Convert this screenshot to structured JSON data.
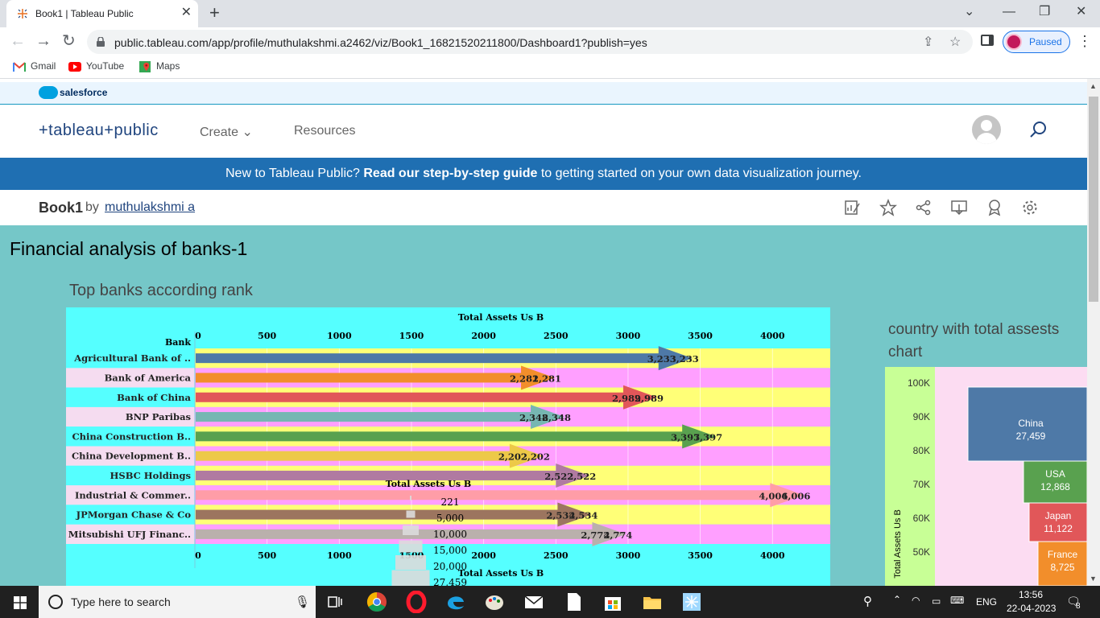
{
  "browser": {
    "tab_title": "Book1 | Tableau Public",
    "url": "public.tableau.com/app/profile/muthulakshmi.a2462/viz/Book1_16821520211800/Dashboard1?publish=yes",
    "profile_label": "Paused",
    "bookmarks": [
      "Gmail",
      "YouTube",
      "Maps"
    ]
  },
  "salesforce_label": "salesforce",
  "header": {
    "logo_text": "+tableau+public",
    "nav": [
      "Create",
      "Resources"
    ]
  },
  "promo": {
    "prefix": "New to Tableau Public? ",
    "bold": "Read our step-by-step guide",
    "suffix": " to getting started on your own data visualization journey."
  },
  "viz": {
    "title": "Book1",
    "by": "by",
    "author": "muthulakshmi a"
  },
  "dashboard": {
    "title": "Financial analysis of banks-1",
    "sheet1_title": "Top banks according rank",
    "sheet2_title": "country with total assests chart"
  },
  "chart_data": [
    {
      "type": "bar",
      "title": "Top banks according rank",
      "xlabel": "Total Assets Us B",
      "row_header": "Bank",
      "categories": [
        "Agricultural Bank of ..",
        "Bank of America",
        "Bank of China",
        "BNP Paribas",
        "China Construction B..",
        "China Development B..",
        "HSBC Holdings",
        "Industrial & Commer..",
        "JPMorgan Chase & Co",
        "Mitsubishi UFJ Financ.."
      ],
      "values": [
        3233,
        2281,
        2989,
        2348,
        3397,
        2202,
        2522,
        4006,
        2534,
        2774
      ],
      "value_labels": [
        "3,233",
        "2,281",
        "2,989",
        "2,348",
        "3,397",
        "2,202",
        "2,522",
        "4,006",
        "2,534",
        "2,774"
      ],
      "bar_colors": [
        "#4e79a7",
        "#f28e2b",
        "#e15759",
        "#76b7b2",
        "#59a14f",
        "#edc948",
        "#b07aa1",
        "#ff9da7",
        "#9c755f",
        "#bab0ac"
      ],
      "ticks": [
        "0",
        "500",
        "1000",
        "1500",
        "2000",
        "2500",
        "3000",
        "3500",
        "4000"
      ],
      "xlim": [
        0,
        4400
      ],
      "size_legend": {
        "title": "Total Assets Us B",
        "entries": [
          "221",
          "5,000",
          "10,000",
          "15,000",
          "20,000",
          "27,459"
        ]
      }
    },
    {
      "type": "treemap",
      "title": "country with total assests chart",
      "ylabel": "Total Assets Us B",
      "y_ticks": [
        "100K",
        "90K",
        "80K",
        "70K",
        "60K",
        "50K"
      ],
      "ylim": [
        40000,
        104000
      ],
      "items": [
        {
          "label": "China",
          "value": "27,459",
          "color": "#4e79a7"
        },
        {
          "label": "USA",
          "value": "12,868",
          "color": "#59a14f"
        },
        {
          "label": "Japan",
          "value": "11,122",
          "color": "#e15759"
        },
        {
          "label": "France",
          "value": "8,725",
          "color": "#f28e2b"
        }
      ]
    }
  ],
  "taskbar": {
    "search_placeholder": "Type here to search",
    "lang": "ENG",
    "time": "13:56",
    "date": "22-04-2023",
    "notifications": "8"
  }
}
